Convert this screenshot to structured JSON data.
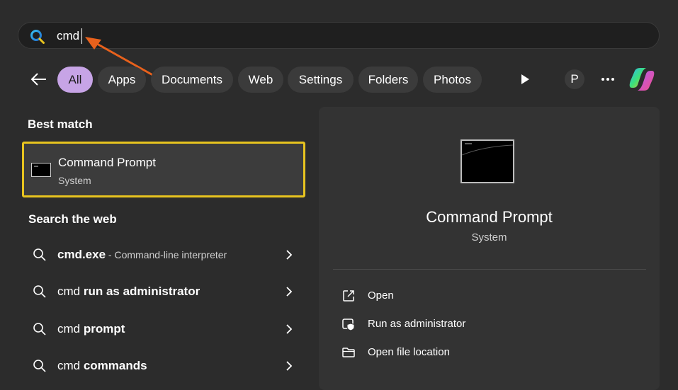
{
  "search": {
    "query": "cmd"
  },
  "filters": {
    "chips": [
      {
        "label": "All"
      },
      {
        "label": "Apps"
      },
      {
        "label": "Documents"
      },
      {
        "label": "Web"
      },
      {
        "label": "Settings"
      },
      {
        "label": "Folders"
      },
      {
        "label": "Photos"
      }
    ],
    "active": "All",
    "profile_initial": "P"
  },
  "best_match": {
    "heading": "Best match",
    "title": "Command Prompt",
    "subtitle": "System"
  },
  "search_web": {
    "heading": "Search the web",
    "items": [
      {
        "plain": "",
        "bold": "cmd.exe",
        "desc": " - Command-line interpreter"
      },
      {
        "plain": "cmd ",
        "bold": "run as administrator",
        "desc": ""
      },
      {
        "plain": "cmd ",
        "bold": "prompt",
        "desc": ""
      },
      {
        "plain": "cmd ",
        "bold": "commands",
        "desc": ""
      }
    ]
  },
  "details": {
    "title": "Command Prompt",
    "subtitle": "System",
    "actions": [
      {
        "label": "Open",
        "icon": "open-external-icon"
      },
      {
        "label": "Run as administrator",
        "icon": "shield-admin-icon"
      },
      {
        "label": "Open file location",
        "icon": "folder-icon"
      }
    ]
  },
  "colors": {
    "background": "#2c2c2c",
    "active_chip": "#c7a4e6",
    "highlight_border": "#e8c41f",
    "annotation_arrow": "#e8611c"
  }
}
